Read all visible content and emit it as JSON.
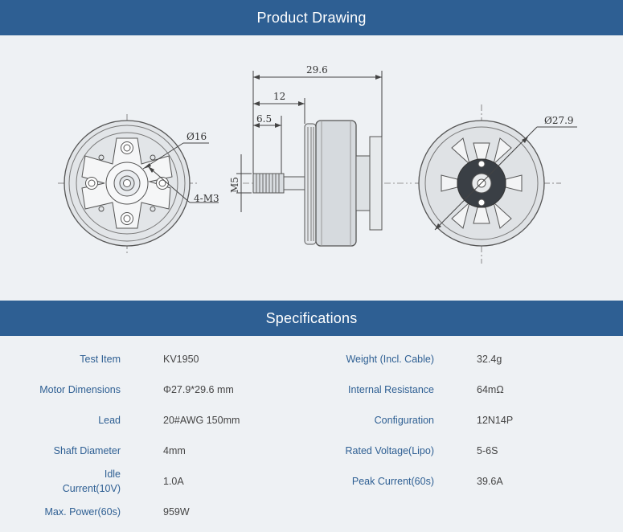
{
  "sections": {
    "drawing_title": "Product Drawing",
    "specs_title": "Specifications"
  },
  "dimensions": {
    "overall_length": "29.6",
    "bell_length": "12",
    "shaft_length": "6.5",
    "shaft_thread": "M5",
    "front_circle": "Ø16",
    "mount_holes": "4-M3",
    "body_diameter": "Ø27.9"
  },
  "specs": {
    "rows": [
      {
        "l1": "Test Item",
        "v1": "KV1950",
        "l2": "Weight (Incl. Cable)",
        "v2": "32.4g"
      },
      {
        "l1": "Motor Dimensions",
        "v1": "Φ27.9*29.6 mm",
        "l2": "Internal Resistance",
        "v2": "64mΩ"
      },
      {
        "l1": "Lead",
        "v1": "20#AWG 150mm",
        "l2": "Configuration",
        "v2": "12N14P"
      },
      {
        "l1": "Shaft Diameter",
        "v1": "4mm",
        "l2": "Rated Voltage(Lipo)",
        "v2": "5-6S"
      },
      {
        "l1": "Idle",
        "l1b": "Current(10V)",
        "v1": "1.0A",
        "l2": "Peak Current(60s)",
        "v2": "39.6A"
      },
      {
        "l1": "Max. Power(60s)",
        "v1": "959W"
      }
    ]
  },
  "colors": {
    "banner": "#2e5f93",
    "label": "#2e5f93",
    "background": "#eef1f4"
  }
}
